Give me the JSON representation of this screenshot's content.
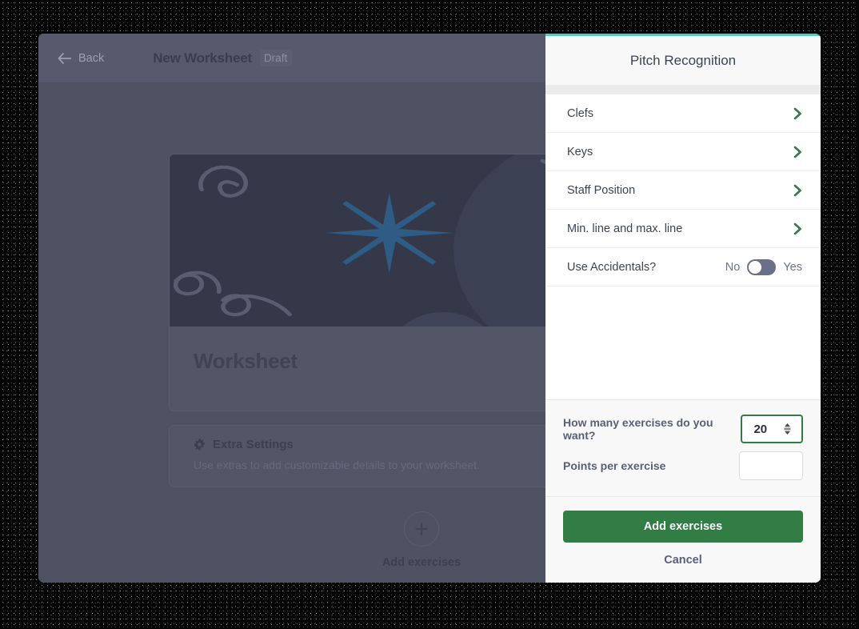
{
  "editor": {
    "back_label": "Back",
    "title": "New Worksheet",
    "status_badge": "Draft",
    "worksheet_name": "Worksheet",
    "extra_settings": {
      "heading": "Extra Settings",
      "description": "Use extras to add customizable details to your worksheet."
    },
    "add_exercises_label": "Add exercises"
  },
  "panel": {
    "title": "Pitch Recognition",
    "accent_top_color": "#5ec5bd",
    "settings": [
      {
        "label": "Clefs",
        "control": "chevron"
      },
      {
        "label": "Keys",
        "control": "chevron"
      },
      {
        "label": "Staff Position",
        "control": "chevron"
      },
      {
        "label": "Min. line and max. line",
        "control": "chevron"
      },
      {
        "label": "Use Accidentals?",
        "control": "toggle"
      }
    ],
    "toggle": {
      "off_label": "No",
      "on_label": "Yes",
      "value": "No"
    },
    "form": {
      "exercise_count_label": "How many exercises do you want?",
      "exercise_count_value": "20",
      "points_label": "Points per exercise",
      "points_value": "",
      "points_placeholder": ""
    },
    "actions": {
      "primary_label": "Add exercises",
      "secondary_label": "Cancel",
      "primary_color": "#327c45"
    }
  }
}
